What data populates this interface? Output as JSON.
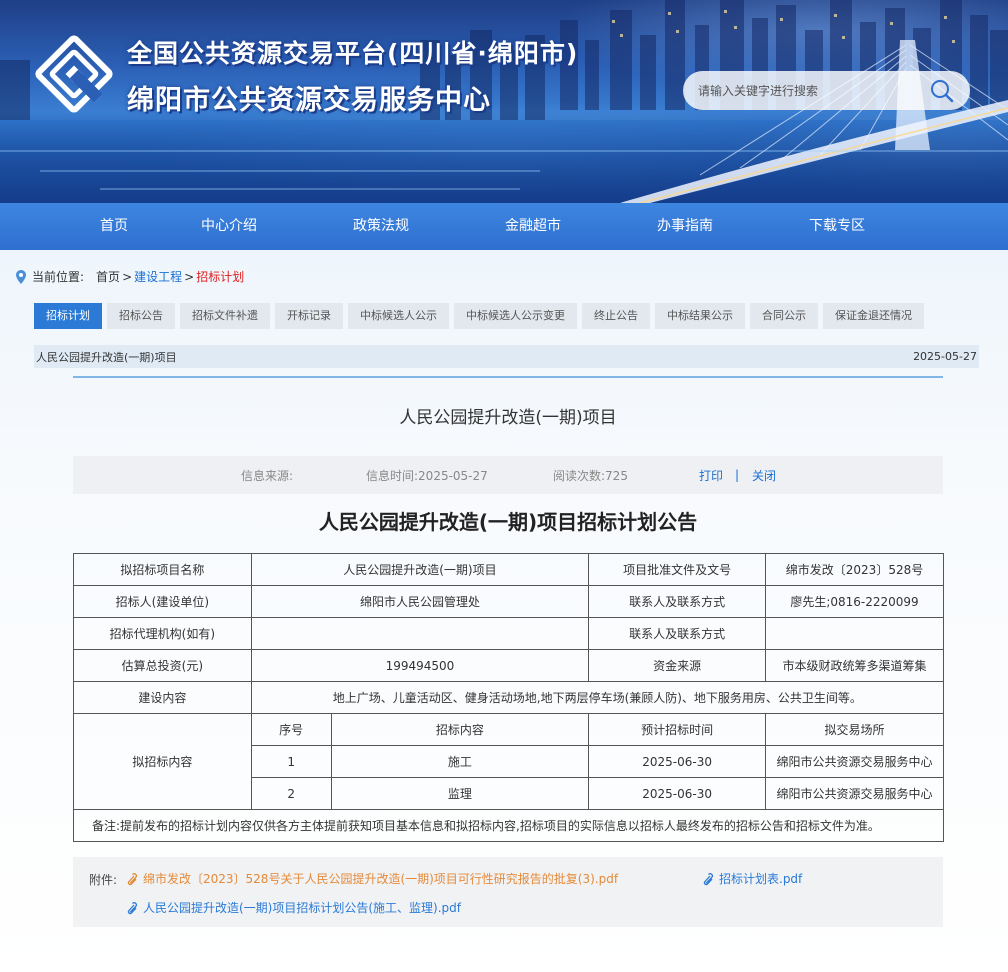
{
  "header": {
    "title_line1": "全国公共资源交易平台(四川省·绵阳市)",
    "title_line2": "绵阳市公共资源交易服务中心",
    "search_placeholder": "请输入关键字进行搜索"
  },
  "nav": [
    "首页",
    "中心介绍",
    "政策法规",
    "金融超市",
    "办事指南",
    "下载专区"
  ],
  "breadcrumb": {
    "label": "当前位置:",
    "items": [
      "首页",
      "建设工程",
      "招标计划"
    ]
  },
  "tabs": [
    "招标计划",
    "招标公告",
    "招标文件补遗",
    "开标记录",
    "中标候选人公示",
    "中标候选人公示变更",
    "终止公告",
    "中标结果公示",
    "合同公示",
    "保证金退还情况"
  ],
  "infobar": {
    "title": "人民公园提升改造(一期)项目",
    "date": "2025-05-27"
  },
  "article": {
    "title": "人民公园提升改造(一期)项目",
    "source": "信息来源:",
    "time": "信息时间:2025-05-27",
    "reads": "阅读次数:725",
    "print": "打印",
    "divider": "|",
    "close": "关闭",
    "notice_title": "人民公园提升改造(一期)项目招标计划公告"
  },
  "table": {
    "row1": [
      "拟招标项目名称",
      "人民公园提升改造(一期)项目",
      "项目批准文件及文号",
      "绵市发改〔2023〕528号"
    ],
    "row2": [
      "招标人(建设单位)",
      "绵阳市人民公园管理处",
      "联系人及联系方式",
      "廖先生;0816-2220099"
    ],
    "row3": [
      "招标代理机构(如有)",
      "",
      "联系人及联系方式",
      ""
    ],
    "row4": [
      "估算总投资(元)",
      "199494500",
      "资金来源",
      "市本级财政统筹多渠道筹集"
    ],
    "row5": [
      "建设内容",
      "地上广场、儿童活动区、健身活动场地,地下两层停车场(兼顾人防)、地下服务用房、公共卫生间等。"
    ],
    "sub_label": "拟招标内容",
    "sub_header": [
      "序号",
      "招标内容",
      "预计招标时间",
      "拟交易场所"
    ],
    "sub_rows": [
      [
        "1",
        "施工",
        "2025-06-30",
        "绵阳市公共资源交易服务中心"
      ],
      [
        "2",
        "监理",
        "2025-06-30",
        "绵阳市公共资源交易服务中心"
      ]
    ],
    "note": "备注:提前发布的招标计划内容仅供各方主体提前获知项目基本信息和拟招标内容,招标项目的实际信息以招标人最终发布的招标公告和招标文件为准。"
  },
  "attachments": {
    "label": "附件:",
    "files": [
      "绵市发改〔2023〕528号关于人民公园提升改造(一期)项目可行性研究报告的批复(3).pdf",
      "招标计划表.pdf",
      "人民公园提升改造(一期)项目招标计划公告(施工、监理).pdf"
    ]
  },
  "colors": {
    "nav_bg": "#2f6fd0",
    "active_tab": "#2a7ad6",
    "link_blue": "#1a6fd1",
    "breadcrumb_current": "#e02020",
    "attachment_orange": "#e48a3a"
  }
}
